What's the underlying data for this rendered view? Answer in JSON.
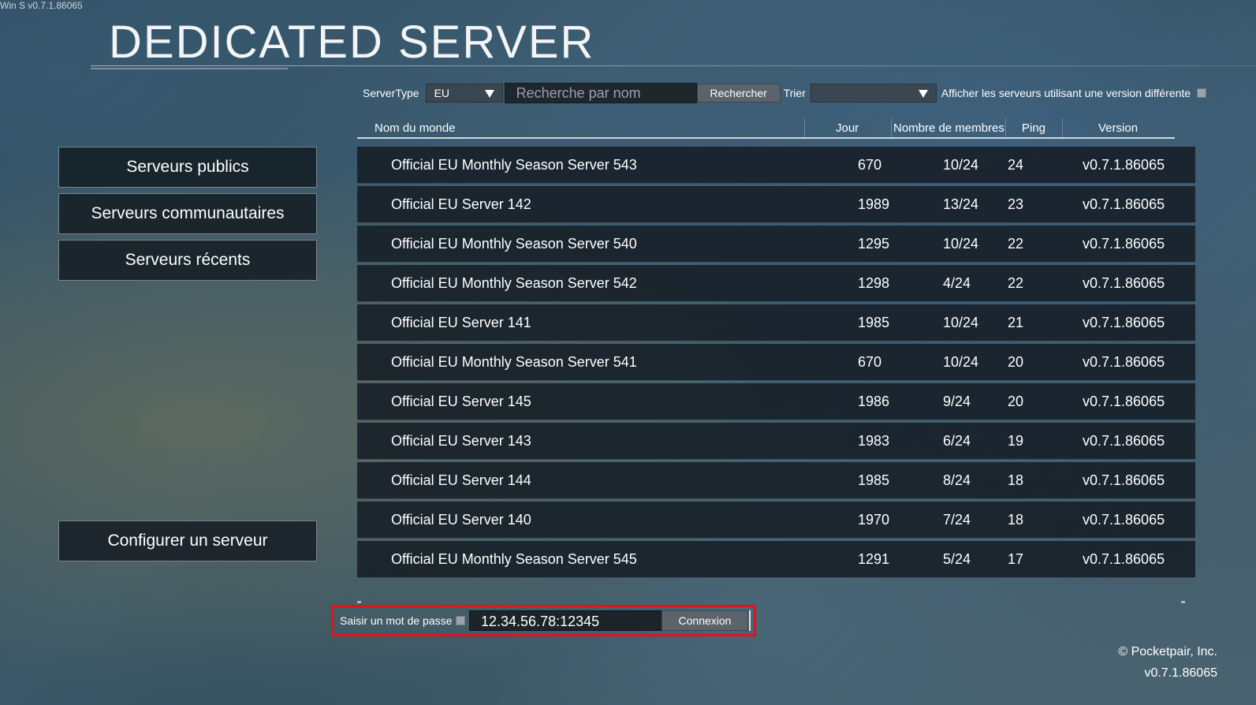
{
  "build_label": "Win S v0.7.1.86065",
  "title": "DEDICATED SERVER",
  "filters": {
    "server_type_label": "ServerType",
    "server_type_value": "EU",
    "search_placeholder": "Recherche par nom",
    "search_button": "Rechercher",
    "sort_label": "Trier",
    "sort_value": "",
    "show_other_versions_label": "Afficher les serveurs utilisant une version différente"
  },
  "sidebar": {
    "items": [
      {
        "label": "Serveurs publics"
      },
      {
        "label": "Serveurs communautaires"
      },
      {
        "label": "Serveurs récents"
      }
    ],
    "configure_label": "Configurer un serveur"
  },
  "table": {
    "headers": {
      "name": "Nom du monde",
      "day": "Jour",
      "members": "Nombre de membres",
      "ping": "Ping",
      "version": "Version"
    },
    "rows": [
      {
        "name": "Official EU Monthly Season Server 543",
        "day": "670",
        "members": "10/24",
        "ping": "24",
        "version": "v0.7.1.86065"
      },
      {
        "name": "Official EU Server 142",
        "day": "1989",
        "members": "13/24",
        "ping": "23",
        "version": "v0.7.1.86065"
      },
      {
        "name": "Official EU Monthly Season Server 540",
        "day": "1295",
        "members": "10/24",
        "ping": "22",
        "version": "v0.7.1.86065"
      },
      {
        "name": "Official EU Monthly Season Server 542",
        "day": "1298",
        "members": "4/24",
        "ping": "22",
        "version": "v0.7.1.86065"
      },
      {
        "name": "Official EU Server 141",
        "day": "1985",
        "members": "10/24",
        "ping": "21",
        "version": "v0.7.1.86065"
      },
      {
        "name": "Official EU Monthly Season Server 541",
        "day": "670",
        "members": "10/24",
        "ping": "20",
        "version": "v0.7.1.86065"
      },
      {
        "name": "Official EU Server 145",
        "day": "1986",
        "members": "9/24",
        "ping": "20",
        "version": "v0.7.1.86065"
      },
      {
        "name": "Official EU Server 143",
        "day": "1983",
        "members": "6/24",
        "ping": "19",
        "version": "v0.7.1.86065"
      },
      {
        "name": "Official EU Server 144",
        "day": "1985",
        "members": "8/24",
        "ping": "18",
        "version": "v0.7.1.86065"
      },
      {
        "name": "Official EU Server 140",
        "day": "1970",
        "members": "7/24",
        "ping": "18",
        "version": "v0.7.1.86065"
      },
      {
        "name": "Official EU Monthly Season Server 545",
        "day": "1291",
        "members": "5/24",
        "ping": "17",
        "version": "v0.7.1.86065"
      }
    ]
  },
  "connect": {
    "password_label": "Saisir un mot de passe",
    "address_value": "12.34.56.78:12345",
    "connect_button": "Connexion",
    "highlight_color": "#e0141b"
  },
  "footer": {
    "copyright": "© Pocketpair, Inc.",
    "version": "v0.7.1.86065"
  }
}
